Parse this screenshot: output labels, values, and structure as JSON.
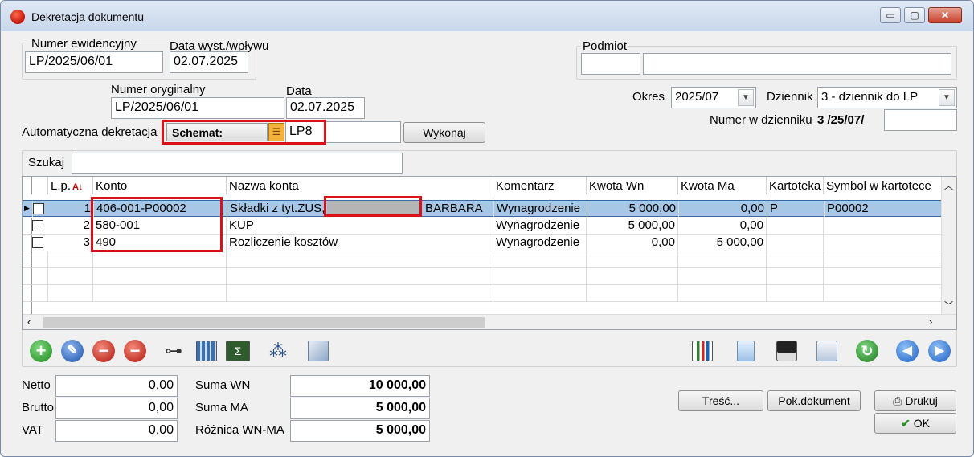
{
  "window": {
    "title": "Dekretacja dokumentu",
    "minimize": "▭",
    "maximize": "▢",
    "close": "✕"
  },
  "header": {
    "numer_ewidencyjny_label": "Numer ewidencyjny",
    "numer_ewidencyjny": "LP/2025/06/01",
    "data_wyst_label": "Data wyst./wpływu",
    "data_wyst": "02.07.2025",
    "podmiot_label": "Podmiot",
    "podmiot_code": "",
    "podmiot_name": "",
    "numer_oryginalny_label": "Numer oryginalny",
    "numer_oryginalny": "LP/2025/06/01",
    "data_label": "Data",
    "data": "02.07.2025",
    "okres_label": "Okres",
    "okres": "2025/07",
    "dziennik_label": "Dziennik",
    "dziennik": "3 - dziennik do LP",
    "numer_w_dzienniku_label": "Numer w dzienniku",
    "numer_w_dzienniku": "3 /25/07/",
    "numer_w_dzienniku_extra": "",
    "auto_dekretacja_label": "Automatyczna dekretacja",
    "schemat_label": "Schemat:",
    "schemat_value": "LP8",
    "schemat_extra": "",
    "wykonaj_label": "Wykonaj"
  },
  "search": {
    "label": "Szukaj",
    "value": ""
  },
  "grid": {
    "columns": [
      "L.p.",
      "Konto",
      "Nazwa konta",
      "Komentarz",
      "Kwota Wn",
      "Kwota Ma",
      "Kartoteka",
      "Symbol w kartotece"
    ],
    "rows": [
      {
        "lp": "1",
        "konto": "406-001-P00002",
        "nazwa": "Składki z tyt.ZUS,",
        "nazwa_suffix": "BARBARA",
        "komentarz": "Wynagrodzenie",
        "wn": "5 000,00",
        "ma": "0,00",
        "kartoteka": "P",
        "symbol": "P00002"
      },
      {
        "lp": "2",
        "konto": "580-001",
        "nazwa": "KUP",
        "nazwa_suffix": "",
        "komentarz": "Wynagrodzenie",
        "wn": "5 000,00",
        "ma": "0,00",
        "kartoteka": "",
        "symbol": ""
      },
      {
        "lp": "3",
        "konto": "490",
        "nazwa": "Rozliczenie kosztów",
        "nazwa_suffix": "",
        "komentarz": "Wynagrodzenie",
        "wn": "0,00",
        "ma": "5 000,00",
        "kartoteka": "",
        "symbol": ""
      }
    ]
  },
  "totals": {
    "netto_label": "Netto",
    "netto": "0,00",
    "brutto_label": "Brutto",
    "brutto": "0,00",
    "vat_label": "VAT",
    "vat": "0,00",
    "suma_wn_label": "Suma WN",
    "suma_wn": "10 000,00",
    "suma_ma_label": "Suma MA",
    "suma_ma": "5 000,00",
    "roznica_label": "Różnica WN-MA",
    "roznica": "5 000,00"
  },
  "buttons": {
    "tresc": "Treść...",
    "pok_dokument": "Pok.dokument",
    "drukuj": "Drukuj",
    "ok": "OK"
  },
  "icons": {
    "add": "plus-circle-icon",
    "edit": "edit-circle-icon",
    "delete": "minus-circle-icon",
    "delete_checked": "minus-check-icon",
    "find": "binoculars-icon",
    "calc": "calculator-grid-icon",
    "sigma": "sum-icon",
    "tree": "tree-icon",
    "export": "export-icon",
    "chart": "chart-icon",
    "doc": "document-icon",
    "save": "floppy-icon",
    "windows": "windows-icon",
    "refresh": "refresh-icon",
    "prev": "prev-icon",
    "next": "next-icon"
  },
  "colors": {
    "selection": "#a7c7e7",
    "highlight": "#d9121a",
    "accent": "#2a7fd4"
  }
}
